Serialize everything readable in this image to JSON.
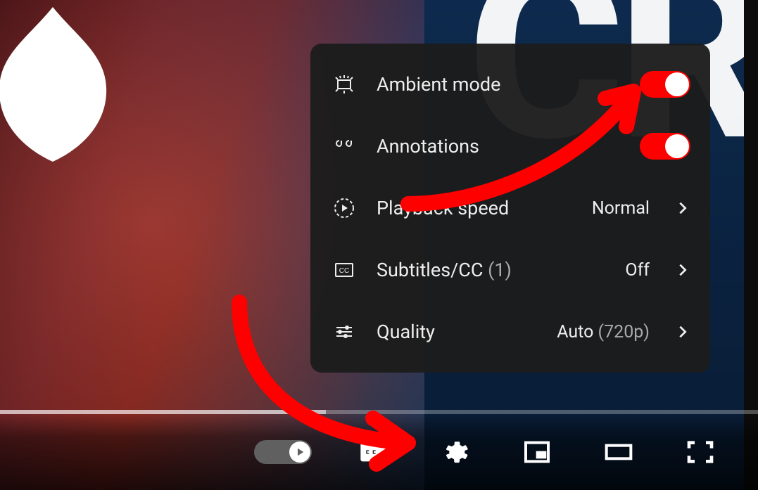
{
  "settings_menu": {
    "items": [
      {
        "label": "Ambient mode",
        "toggle": true
      },
      {
        "label": "Annotations",
        "toggle": true
      },
      {
        "label": "Playback speed",
        "value": "Normal"
      },
      {
        "label": "Subtitles/CC",
        "label_suffix": "(1)",
        "value": "Off"
      },
      {
        "label": "Quality",
        "value": "Auto",
        "value_suffix": "(720p)"
      }
    ]
  },
  "controls": {
    "autoplay": true
  },
  "colors": {
    "toggle_on": "#ff0000"
  }
}
